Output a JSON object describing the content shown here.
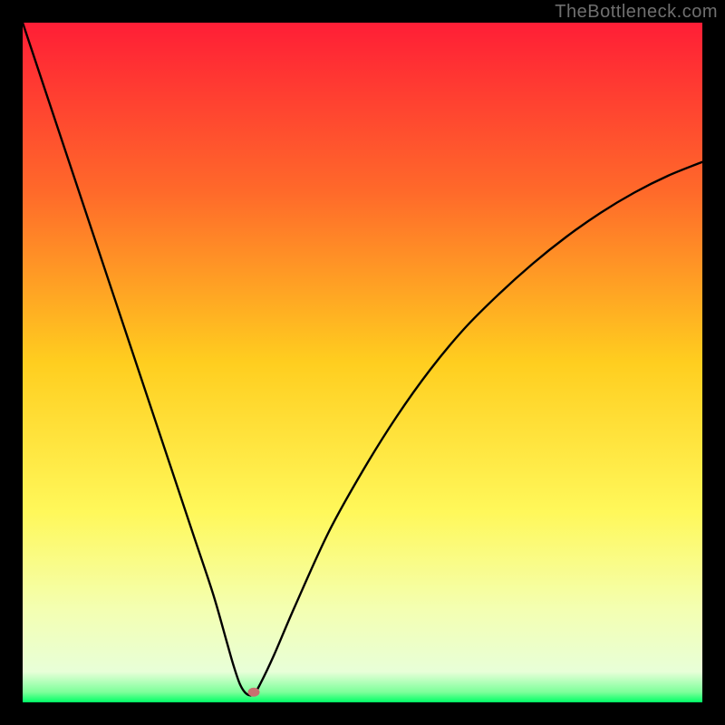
{
  "watermark": "TheBottleneck.com",
  "chart_data": {
    "type": "line",
    "title": "",
    "xlabel": "",
    "ylabel": "",
    "xlim": [
      0,
      100
    ],
    "ylim": [
      0,
      100
    ],
    "grid": false,
    "valley_x": 33,
    "marker": {
      "x": 34,
      "y": 1.5,
      "color": "#c87070"
    },
    "green_band": {
      "y_start": 0,
      "y_end": 3
    },
    "gradient_stops": [
      {
        "offset": 0.0,
        "color": "#ff1e36"
      },
      {
        "offset": 0.25,
        "color": "#ff6a2a"
      },
      {
        "offset": 0.5,
        "color": "#ffce1f"
      },
      {
        "offset": 0.72,
        "color": "#fff85a"
      },
      {
        "offset": 0.86,
        "color": "#f4ffb0"
      },
      {
        "offset": 0.955,
        "color": "#e8ffd8"
      },
      {
        "offset": 0.985,
        "color": "#7dff9a"
      },
      {
        "offset": 1.0,
        "color": "#00ff66"
      }
    ],
    "series": [
      {
        "name": "curve",
        "x": [
          0,
          5,
          10,
          15,
          20,
          25,
          28,
          30,
          31,
          32,
          33,
          34,
          35,
          37,
          40,
          45,
          50,
          55,
          60,
          65,
          70,
          75,
          80,
          85,
          90,
          95,
          100
        ],
        "y": [
          100,
          85,
          70,
          55,
          40,
          25,
          16,
          9,
          5.5,
          2.6,
          1.2,
          1.2,
          2.8,
          7,
          14,
          25,
          34,
          42,
          49,
          55,
          60,
          64.5,
          68.5,
          72,
          75,
          77.5,
          79.5
        ]
      }
    ]
  }
}
